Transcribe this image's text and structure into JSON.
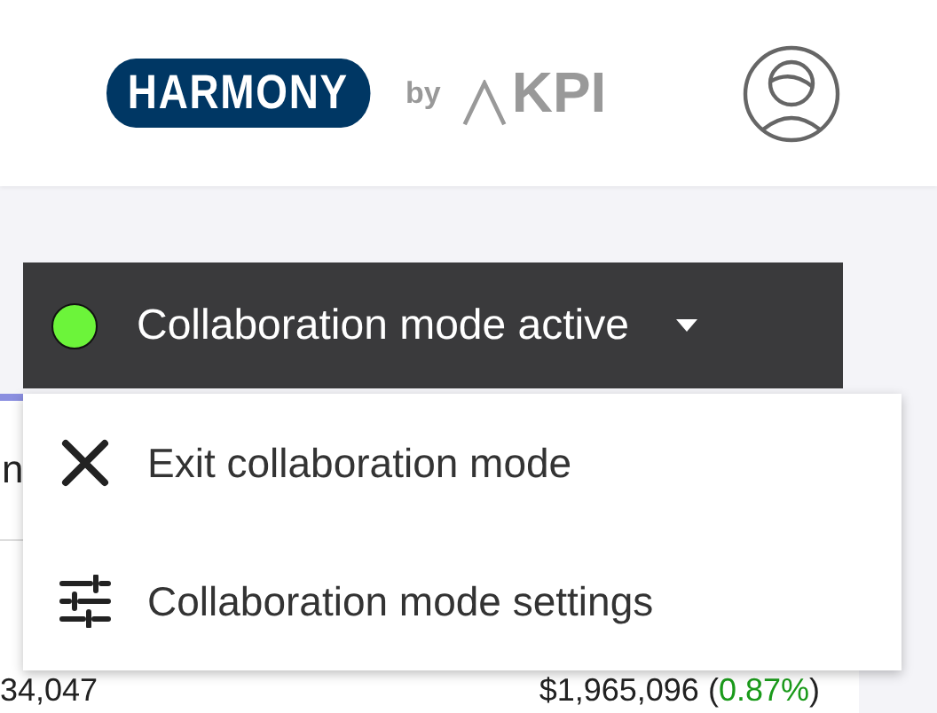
{
  "header": {
    "logo": "HARMONY",
    "by": "by",
    "brand": "KPI"
  },
  "collaboration": {
    "label": "Collaboration mode active",
    "active": true,
    "expanded": true
  },
  "menu": [
    {
      "kind": "exit",
      "label": "Exit collaboration mode"
    },
    {
      "kind": "settings",
      "label": "Collaboration mode settings"
    }
  ],
  "table": {
    "row_1": "n",
    "row_3": {
      "cell_1": "34,047",
      "cell_2": "$1,965,096 (",
      "change": "0.87%",
      "close": ")"
    }
  }
}
